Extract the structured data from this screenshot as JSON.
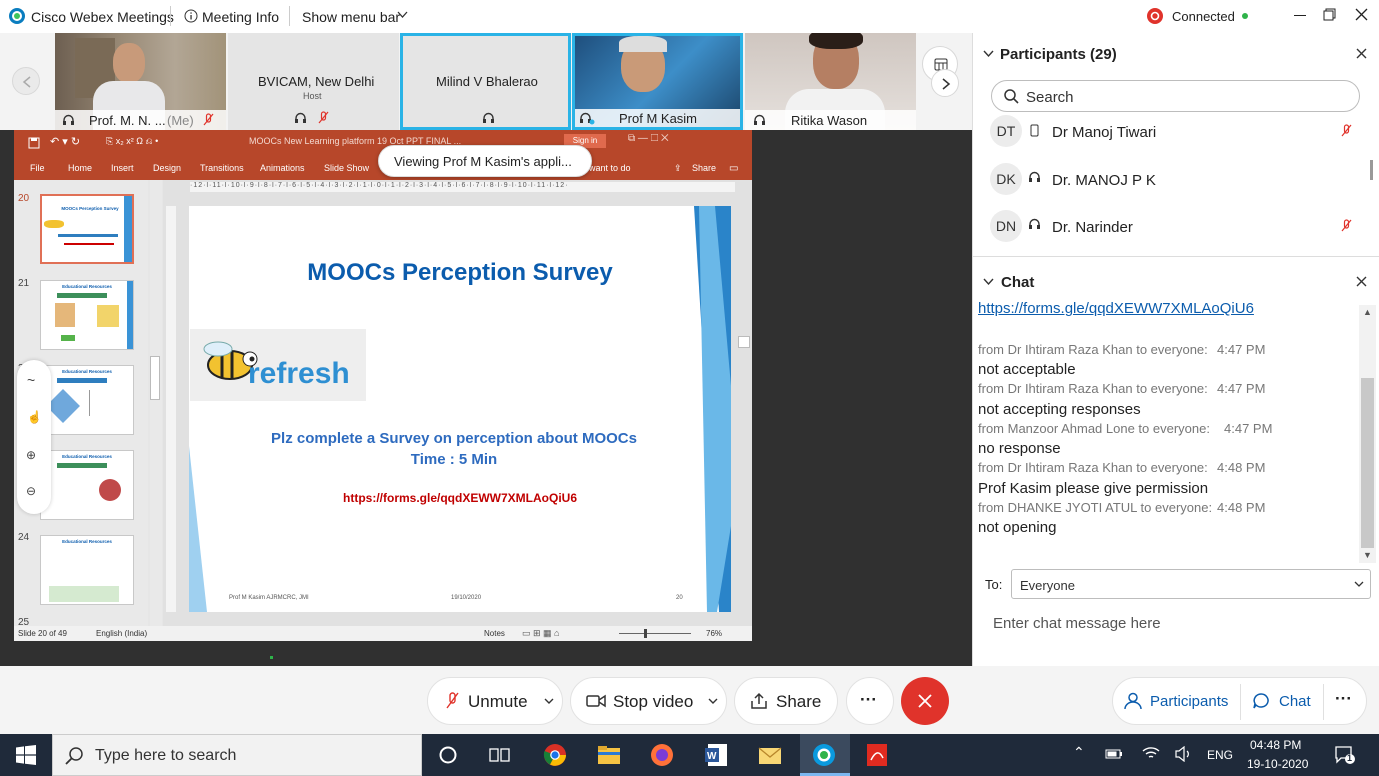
{
  "window": {
    "app_title": "Cisco Webex Meetings",
    "meeting_info": "Meeting Info",
    "show_menu_bar": "Show menu bar",
    "status": "Connected"
  },
  "videos": [
    {
      "name": "Prof. M. N. ...",
      "tag": "(Me)"
    },
    {
      "name": "BVICAM, New Delhi",
      "role": "Host"
    },
    {
      "name": "Milind V Bhalerao"
    },
    {
      "name": "Prof M Kasim"
    },
    {
      "name": "Ritika Wason"
    }
  ],
  "share": {
    "viewing_banner": "Viewing Prof M Kasim's appli...",
    "ppt_title": "MOOCs New Learning platform 19 Oct PPT FINAL ...",
    "sign_in": "Sign in",
    "menus": [
      "File",
      "Home",
      "Insert",
      "Design",
      "Transitions",
      "Animations",
      "Slide Show"
    ],
    "tell_me": "want to do",
    "share": "Share",
    "thumb_numbers": [
      "20",
      "21",
      "22",
      "23",
      "24",
      "25"
    ],
    "thumb_titles": [
      "MOOCs Perception Survey",
      "Educational Resources",
      "Educational Resources",
      "Educational Resources",
      "Educational Resources"
    ],
    "slide": {
      "title": "MOOCs Perception Survey",
      "logo_text": "refresh",
      "line1": "Plz complete a Survey on perception about MOOCs",
      "line2": "Time : 5 Min",
      "link": "https://forms.gle/qqdXEWW7XMLAoQiU6",
      "footer_left": "Prof M Kasim AJRMCRC, JMI",
      "footer_date": "19/10/2020",
      "footer_num": "20"
    },
    "status": {
      "slide_of": "Slide 20 of 49",
      "language": "English (India)",
      "notes": "Notes",
      "zoom": "76%"
    }
  },
  "participants": {
    "header": "Participants (29)",
    "search_placeholder": "Search",
    "list": [
      {
        "initials": "DT",
        "name": "Dr Manoj Tiwari"
      },
      {
        "initials": "DK",
        "name": "Dr. MANOJ P K"
      },
      {
        "initials": "DN",
        "name": "Dr. Narinder"
      }
    ]
  },
  "chat": {
    "header": "Chat",
    "link": "https://forms.gle/qqdXEWW7XMLAoQiU6",
    "messages": [
      {
        "meta": "from Dr Ihtiram Raza Khan to everyone:",
        "time": "4:47 PM",
        "text": "not acceptable"
      },
      {
        "meta": "from Dr Ihtiram Raza Khan to everyone:",
        "time": "4:47 PM",
        "text": "not accepting responses"
      },
      {
        "meta": "from Manzoor Ahmad Lone to everyone:",
        "time": "4:47 PM",
        "text": "no response"
      },
      {
        "meta": "from Dr Ihtiram Raza Khan to everyone:",
        "time": "4:48 PM",
        "text": "Prof Kasim please give permission"
      },
      {
        "meta": "from DHANKE JYOTI ATUL to everyone:",
        "time": "4:48 PM",
        "text": "not opening"
      }
    ],
    "to_label": "To:",
    "to_value": "Everyone",
    "input_placeholder": "Enter chat message here"
  },
  "controls": {
    "unmute": "Unmute",
    "stop_video": "Stop video",
    "share": "Share",
    "more": "···",
    "participants": "Participants",
    "chat": "Chat"
  },
  "taskbar": {
    "search_placeholder": "Type here to search",
    "lang": "ENG",
    "time": "04:48 PM",
    "date": "19-10-2020",
    "notif_count": "1"
  },
  "colors": {
    "accent_blue": "#0b5cad",
    "tile_border": "#2ab3e6",
    "ppt_red": "#b7472a",
    "end_red": "#e0332b",
    "taskbar": "#1f2a3a"
  }
}
